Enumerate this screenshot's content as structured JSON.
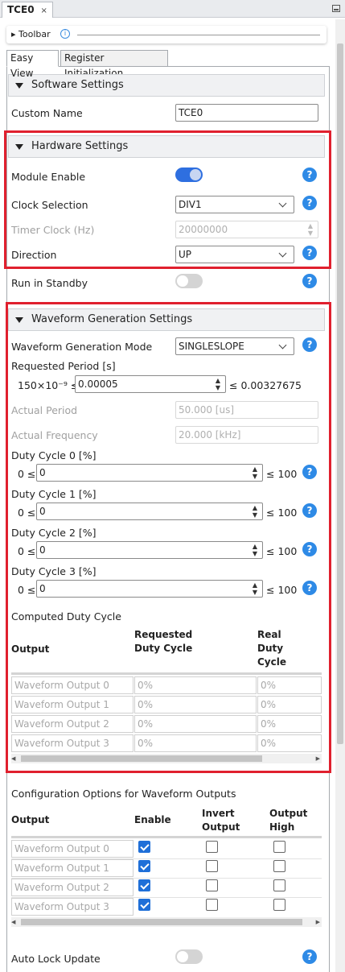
{
  "tab": {
    "title": "TCE0",
    "close": "×"
  },
  "toolbar": {
    "label": "Toolbar",
    "info": "i"
  },
  "view_tabs": [
    "Easy View",
    "Register Initialization"
  ],
  "software": {
    "title": "Software Settings",
    "custom_name_label": "Custom Name",
    "custom_name_value": "TCE0"
  },
  "hardware": {
    "title": "Hardware Settings",
    "module_enable_label": "Module Enable",
    "module_enable": true,
    "clock_label": "Clock Selection",
    "clock_value": "DIV1",
    "timer_clock_label": "Timer Clock (Hz)",
    "timer_clock_value": "20000000",
    "direction_label": "Direction",
    "direction_value": "UP"
  },
  "standby": {
    "label": "Run in Standby",
    "value": false
  },
  "waveform": {
    "title": "Waveform Generation Settings",
    "mode_label": "Waveform Generation Mode",
    "mode_value": "SINGLESLOPE",
    "period_label": "Requested Period [s]",
    "period_min": "150×10⁻⁹ ≤",
    "period_value": "0.00005",
    "period_max": "≤ 0.00327675",
    "actual_period_label": "Actual Period",
    "actual_period_value": "50.000 [us]",
    "actual_freq_label": "Actual Frequency",
    "actual_freq_value": "20.000 [kHz]",
    "duty": [
      {
        "label": "Duty Cycle 0 [%]",
        "min": "0 ≤",
        "value": "0",
        "max": "≤ 100"
      },
      {
        "label": "Duty Cycle 1 [%]",
        "min": "0 ≤",
        "value": "0",
        "max": "≤ 100"
      },
      {
        "label": "Duty Cycle 2 [%]",
        "min": "0 ≤",
        "value": "0",
        "max": "≤ 100"
      },
      {
        "label": "Duty Cycle 3 [%]",
        "min": "0 ≤",
        "value": "0",
        "max": "≤ 100"
      }
    ],
    "computed_label": "Computed Duty Cycle",
    "computed_headers": [
      "Output",
      "Requested Duty Cycle",
      "Real Duty Cycle"
    ],
    "computed_rows": [
      {
        "output": "Waveform Output 0",
        "requested": "0%",
        "real": "0%"
      },
      {
        "output": "Waveform Output 1",
        "requested": "0%",
        "real": "0%"
      },
      {
        "output": "Waveform Output 2",
        "requested": "0%",
        "real": "0%"
      },
      {
        "output": "Waveform Output 3",
        "requested": "0%",
        "real": "0%"
      }
    ]
  },
  "config": {
    "label": "Configuration Options for Waveform Outputs",
    "headers": [
      "Output",
      "Enable",
      "Invert Output",
      "Output High"
    ],
    "rows": [
      {
        "output": "Waveform Output 0",
        "enable": true,
        "invert": false,
        "high": false
      },
      {
        "output": "Waveform Output 1",
        "enable": true,
        "invert": false,
        "high": false
      },
      {
        "output": "Waveform Output 2",
        "enable": true,
        "invert": false,
        "high": false
      },
      {
        "output": "Waveform Output 3",
        "enable": true,
        "invert": false,
        "high": false
      }
    ]
  },
  "auto_lock": {
    "label": "Auto Lock Update",
    "value": false
  },
  "help_glyph": "?",
  "colors": {
    "highlight": "#e0202e",
    "accent": "#2e8ae6",
    "toggle_on": "#2e6fe0"
  }
}
